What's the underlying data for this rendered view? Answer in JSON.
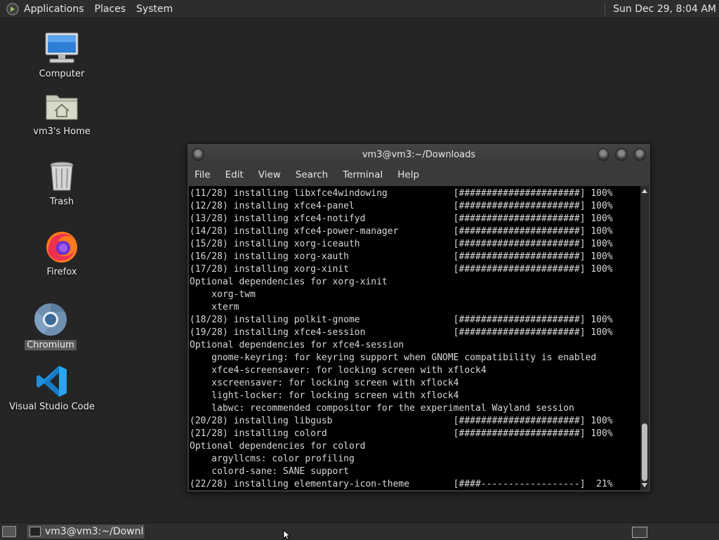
{
  "top_panel": {
    "menu": [
      "Applications",
      "Places",
      "System"
    ],
    "clock": "Sun Dec 29,  8:04 AM"
  },
  "desktop_icons": [
    {
      "label": "Computer",
      "icon": "computer-icon"
    },
    {
      "label": "vm3's Home",
      "icon": "home-folder-icon"
    },
    {
      "label": "Trash",
      "icon": "trash-icon"
    },
    {
      "label": "Firefox",
      "icon": "firefox-icon"
    },
    {
      "label": "Chromium",
      "icon": "chromium-icon",
      "selected": true
    },
    {
      "label": "Visual Studio Code",
      "icon": "vscode-icon"
    }
  ],
  "terminal": {
    "title": "vm3@vm3:~/Downloads",
    "menu": [
      "File",
      "Edit",
      "View",
      "Search",
      "Terminal",
      "Help"
    ],
    "lines": [
      "(11/28) installing libxfce4windowing            [######################] 100%",
      "(12/28) installing xfce4-panel                  [######################] 100%",
      "(13/28) installing xfce4-notifyd                [######################] 100%",
      "(14/28) installing xfce4-power-manager          [######################] 100%",
      "(15/28) installing xorg-iceauth                 [######################] 100%",
      "(16/28) installing xorg-xauth                   [######################] 100%",
      "(17/28) installing xorg-xinit                   [######################] 100%",
      "Optional dependencies for xorg-xinit",
      "    xorg-twm",
      "    xterm",
      "(18/28) installing polkit-gnome                 [######################] 100%",
      "(19/28) installing xfce4-session                [######################] 100%",
      "Optional dependencies for xfce4-session",
      "    gnome-keyring: for keyring support when GNOME compatibility is enabled",
      "    xfce4-screensaver: for locking screen with xflock4",
      "    xscreensaver: for locking screen with xflock4",
      "    light-locker: for locking screen with xflock4",
      "    labwc: recommended compositor for the experimental Wayland session",
      "(20/28) installing libgusb                      [######################] 100%",
      "(21/28) installing colord                       [######################] 100%",
      "Optional dependencies for colord",
      "    argyllcms: color profiling",
      "    colord-sane: SANE support",
      "(22/28) installing elementary-icon-theme        [####------------------]  21%"
    ]
  },
  "taskbar": {
    "task_label": "vm3@vm3:~/Downl..."
  }
}
